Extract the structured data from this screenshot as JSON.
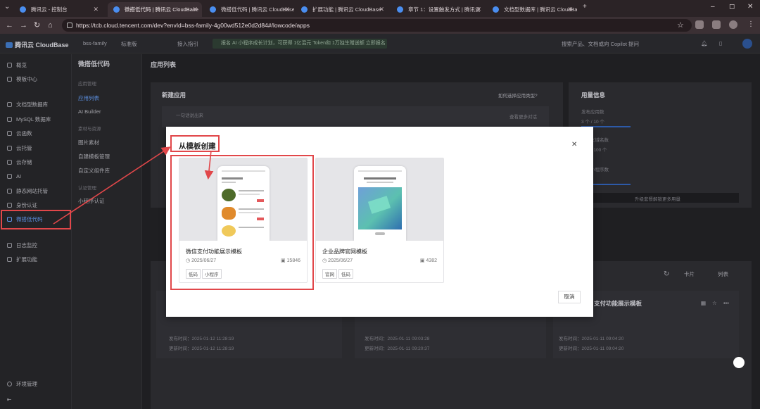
{
  "browser": {
    "tabs": [
      {
        "label": "腾讯云 - 控制台"
      },
      {
        "label": "微搭低代码 | 腾讯云 CloudBase"
      },
      {
        "label": "微搭低代码 | 腾讯云 CloudBase"
      },
      {
        "label": "扩展功能 | 腾讯云 CloudBase"
      },
      {
        "label": "章节 1：设置触发方式 | 腾讯云"
      },
      {
        "label": "文档型数据库 | 腾讯云 CloudBase"
      }
    ],
    "url": "https://tcb.cloud.tencent.com/dev?envId=bss-family-4g00wd512e0d2d84#/lowcode/apps"
  },
  "header": {
    "logo": "腾讯云 CloudBase",
    "env": "bss-family",
    "env_tag": "标准版",
    "guide": "接入指引",
    "notice": "报名 AI 小程序成长计划，可获得 1亿混元 Token和 1万独生赠送额 立即报名",
    "search_placeholder": "搜索产品、文档或向 Copilot 提问"
  },
  "sidebar": {
    "items": [
      {
        "label": "概览"
      },
      {
        "label": "模板中心"
      },
      {
        "label": "文档型数据库"
      },
      {
        "label": "MySQL 数据库"
      },
      {
        "label": "云函数"
      },
      {
        "label": "云托管"
      },
      {
        "label": "云存储"
      },
      {
        "label": "AI"
      },
      {
        "label": "静态网站托管"
      },
      {
        "label": "身份认证"
      },
      {
        "label": "微搭低代码"
      },
      {
        "label": "日志监控"
      },
      {
        "label": "扩展功能"
      }
    ],
    "env_manage": "环境管理"
  },
  "subnav": {
    "title": "微搭低代码",
    "group1": "应用管理",
    "items1": [
      "应用列表",
      "AI Builder"
    ],
    "group2": "素材与资源",
    "items2": [
      "图片素材",
      "自建模板管理",
      "自定义组件库"
    ],
    "group3": "认证管理",
    "items3": [
      "小程序认证"
    ]
  },
  "main": {
    "page_title": "应用列表",
    "new_app": "新建应用",
    "how_to": "如何选择应用类型?",
    "prompt_placeholder": "一句话说出来",
    "more_examples": "查看更多对话",
    "usage_title": "用量信息",
    "usage_apps": "发布应用数",
    "usage_apps_value": "3 个 / 10 个",
    "usage_domain": "自定义域名数",
    "usage_domain_value": "0 个 / 100 个",
    "usage_miniprogram": "授权小程序数",
    "upgrade": "升级套餐解锁更多用量",
    "view_card": "卡片",
    "view_list": "列表",
    "bg_card_title": "支付功能展示模板",
    "publish_label": "发布时间",
    "update_label": "更新时间",
    "times": [
      {
        "pub": "发布时间：2025-01-12 11:28:19",
        "upd": "更新时间：2025-01-12 11:28:19"
      },
      {
        "pub": "发布时间：2025-01-11 09:03:28",
        "upd": "更新时间：2025-01-11 09:20:37"
      },
      {
        "pub": "发布时间：2025-01-11 09:04:20",
        "upd": "更新时间：2025-01-11 09:04:20"
      }
    ]
  },
  "modal": {
    "title": "从模板创建",
    "cancel": "取消",
    "templates": [
      {
        "name": "微信支付功能展示模板",
        "date": "2025/06/27",
        "uses": "15846",
        "tags": [
          "低码",
          "小程序"
        ]
      },
      {
        "name": "企业品牌官网模板",
        "date": "2025/06/27",
        "uses": "4382",
        "tags": [
          "官网",
          "低码"
        ]
      }
    ]
  },
  "colors": {
    "annotation_red": "#e1474a",
    "accent_blue": "#0052d9"
  }
}
